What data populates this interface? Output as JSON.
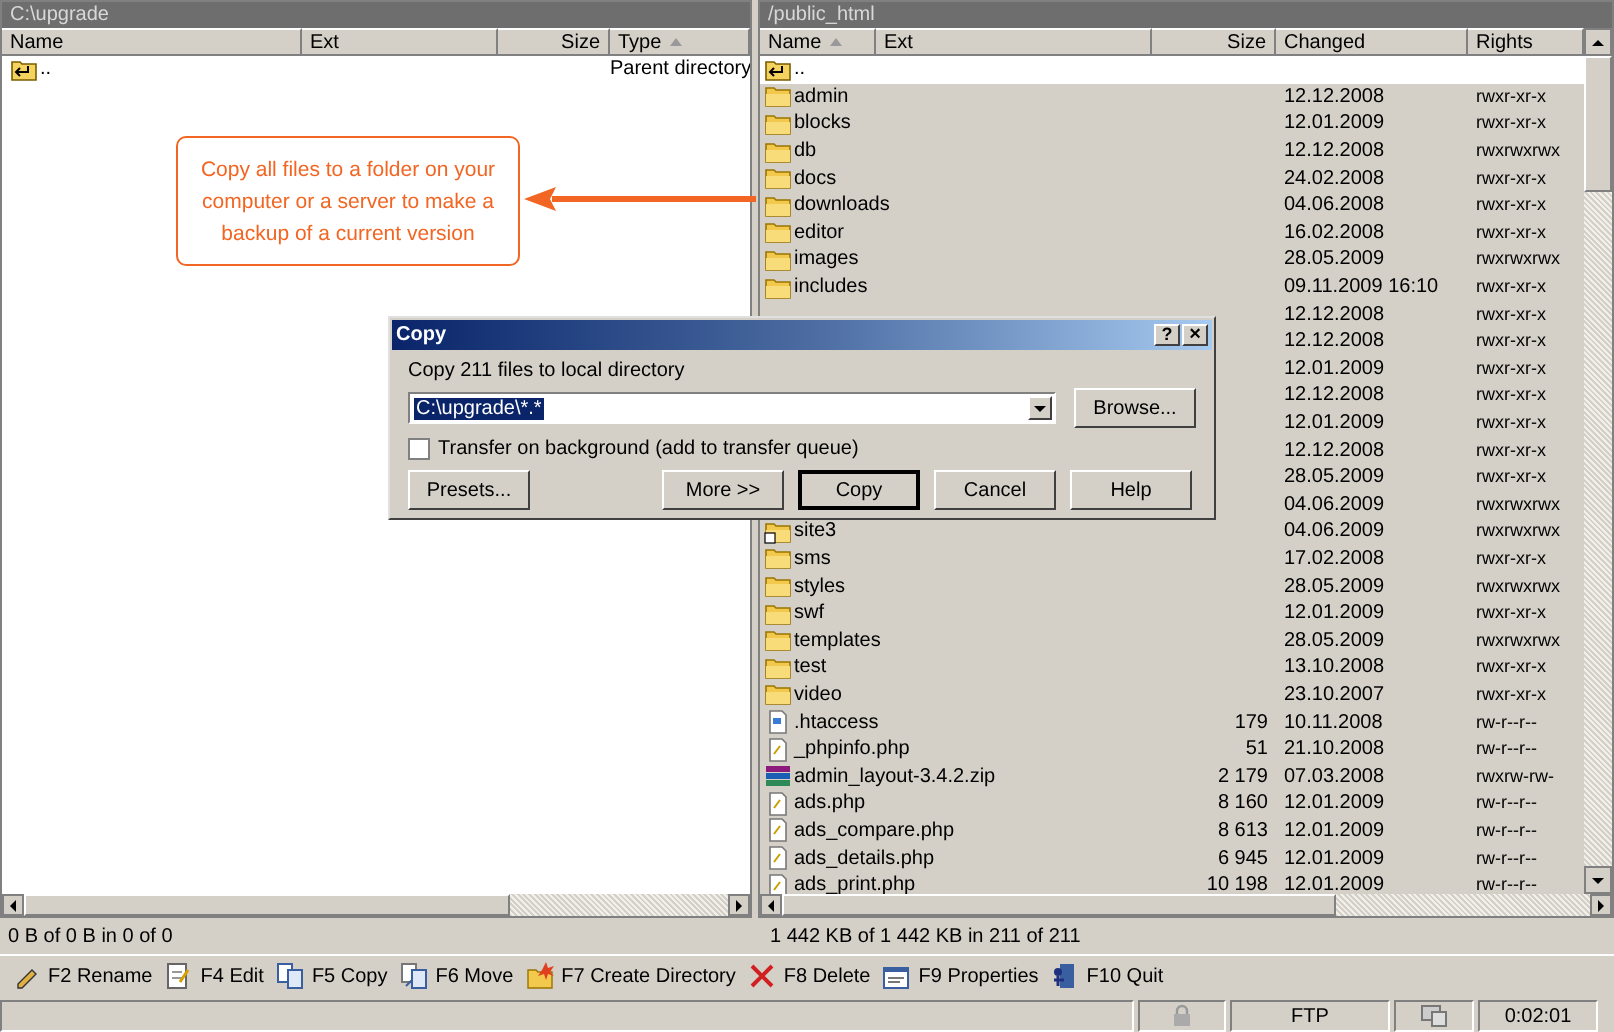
{
  "left_panel": {
    "path": "C:\\upgrade",
    "columns": [
      {
        "label": "Name",
        "sorted": false
      },
      {
        "label": "Ext",
        "sorted": false
      },
      {
        "label": "Size",
        "sorted": false
      },
      {
        "label": "Type",
        "sorted": true
      }
    ],
    "rows": [
      {
        "kind": "up",
        "name": "..",
        "type": "Parent directory",
        "selected": false
      }
    ],
    "status": "0 B of 0 B in 0 of 0"
  },
  "right_panel": {
    "path": "/public_html",
    "columns": [
      {
        "label": "Name",
        "sorted": true
      },
      {
        "label": "Ext",
        "sorted": false
      },
      {
        "label": "Size",
        "sorted": false
      },
      {
        "label": "Changed",
        "sorted": false
      },
      {
        "label": "Rights",
        "sorted": false
      }
    ],
    "rows": [
      {
        "kind": "up",
        "name": "..",
        "selected": true
      },
      {
        "kind": "folder",
        "name": "admin",
        "changed": "12.12.2008",
        "rights": "rwxr-xr-x",
        "selected": false
      },
      {
        "kind": "folder",
        "name": "blocks",
        "changed": "12.01.2009",
        "rights": "rwxr-xr-x",
        "selected": false
      },
      {
        "kind": "folder",
        "name": "db",
        "changed": "12.12.2008",
        "rights": "rwxrwxrwx",
        "selected": false
      },
      {
        "kind": "folder",
        "name": "docs",
        "changed": "24.02.2008",
        "rights": "rwxr-xr-x",
        "selected": false
      },
      {
        "kind": "folder",
        "name": "downloads",
        "changed": "04.06.2008",
        "rights": "rwxr-xr-x",
        "selected": false
      },
      {
        "kind": "folder",
        "name": "editor",
        "changed": "16.02.2008",
        "rights": "rwxr-xr-x",
        "selected": false
      },
      {
        "kind": "folder",
        "name": "images",
        "changed": "28.05.2009",
        "rights": "rwxrwxrwx",
        "selected": false
      },
      {
        "kind": "folder",
        "name": "includes",
        "changed": "09.11.2009 16:10",
        "rights": "rwxr-xr-x",
        "selected": false
      },
      {
        "changed": "12.12.2008",
        "rights": "rwxr-xr-x",
        "selected": false
      },
      {
        "changed": "12.12.2008",
        "rights": "rwxr-xr-x",
        "selected": false
      },
      {
        "changed": "12.01.2009",
        "rights": "rwxr-xr-x",
        "selected": false
      },
      {
        "changed": "12.12.2008",
        "rights": "rwxr-xr-x",
        "selected": false
      },
      {
        "changed": "12.01.2009",
        "rights": "rwxr-xr-x",
        "selected": false
      },
      {
        "changed": "12.12.2008",
        "rights": "rwxr-xr-x",
        "selected": false
      },
      {
        "changed": "28.05.2009",
        "rights": "rwxr-xr-x",
        "selected": false
      },
      {
        "changed": "04.06.2009",
        "rights": "rwxrwxrwx",
        "selected": false
      },
      {
        "kind": "link",
        "name": "site3",
        "changed": "04.06.2009",
        "rights": "rwxrwxrwx",
        "selected": false
      },
      {
        "kind": "folder",
        "name": "sms",
        "changed": "17.02.2008",
        "rights": "rwxr-xr-x",
        "selected": false
      },
      {
        "kind": "folder",
        "name": "styles",
        "changed": "28.05.2009",
        "rights": "rwxrwxrwx",
        "selected": false
      },
      {
        "kind": "folder",
        "name": "swf",
        "changed": "12.01.2009",
        "rights": "rwxr-xr-x",
        "selected": false
      },
      {
        "kind": "folder",
        "name": "templates",
        "changed": "28.05.2009",
        "rights": "rwxrwxrwx",
        "selected": false
      },
      {
        "kind": "folder",
        "name": "test",
        "changed": "13.10.2008",
        "rights": "rwxr-xr-x",
        "selected": false
      },
      {
        "kind": "folder",
        "name": "video",
        "changed": "23.10.2007",
        "rights": "rwxr-xr-x",
        "selected": false
      },
      {
        "kind": "config",
        "name": ".htaccess",
        "size": "179",
        "changed": "10.11.2008",
        "rights": "rw-r--r--",
        "selected": false
      },
      {
        "kind": "script",
        "name": "_phpinfo.php",
        "size": "51",
        "changed": "21.10.2008",
        "rights": "rw-r--r--",
        "selected": false
      },
      {
        "kind": "archive",
        "name": "admin_layout-3.4.2.zip",
        "size": "2 179",
        "changed": "07.03.2008",
        "rights": "rwxrw-rw-",
        "selected": false
      },
      {
        "kind": "script",
        "name": "ads.php",
        "size": "8 160",
        "changed": "12.01.2009",
        "rights": "rw-r--r--",
        "selected": false
      },
      {
        "kind": "script",
        "name": "ads_compare.php",
        "size": "8 613",
        "changed": "12.01.2009",
        "rights": "rw-r--r--",
        "selected": false
      },
      {
        "kind": "script",
        "name": "ads_details.php",
        "size": "6 945",
        "changed": "12.01.2009",
        "rights": "rw-r--r--",
        "selected": false
      },
      {
        "kind": "script",
        "name": "ads_print.php",
        "size": "10 198",
        "changed": "12.01.2009",
        "rights": "rw-r--r--",
        "selected": false
      }
    ],
    "status": "1 442 KB of 1 442 KB in 211 of 211"
  },
  "callout": {
    "text": "Copy all files to a folder on your computer or a server to make a backup of a current version"
  },
  "dialog": {
    "title": "Copy",
    "help": "?",
    "close": "×",
    "prompt": "Copy 211 files to local directory",
    "target": "C:\\upgrade\\*.*",
    "browse": "Browse...",
    "background_transfer": {
      "label": "Transfer on background (add to transfer queue)",
      "checked": false
    },
    "buttons": [
      {
        "label": "Presets...",
        "default": false
      },
      {
        "label": "More >>",
        "default": false
      },
      {
        "label": "Copy",
        "default": true
      },
      {
        "label": "Cancel",
        "default": false
      },
      {
        "label": "Help",
        "default": false
      }
    ]
  },
  "toolbar": [
    {
      "kind": "rename",
      "label": "F2 Rename"
    },
    {
      "kind": "edit",
      "label": "F4 Edit"
    },
    {
      "kind": "copy",
      "label": "F5 Copy"
    },
    {
      "kind": "move",
      "label": "F6 Move"
    },
    {
      "kind": "mkdir",
      "label": "F7 Create Directory"
    },
    {
      "kind": "delete",
      "label": "F8 Delete"
    },
    {
      "kind": "properties",
      "label": "F9 Properties"
    },
    {
      "kind": "quit",
      "label": "F10 Quit"
    }
  ],
  "status_bar": {
    "protocol": "FTP",
    "elapsed": "0:02:01"
  }
}
